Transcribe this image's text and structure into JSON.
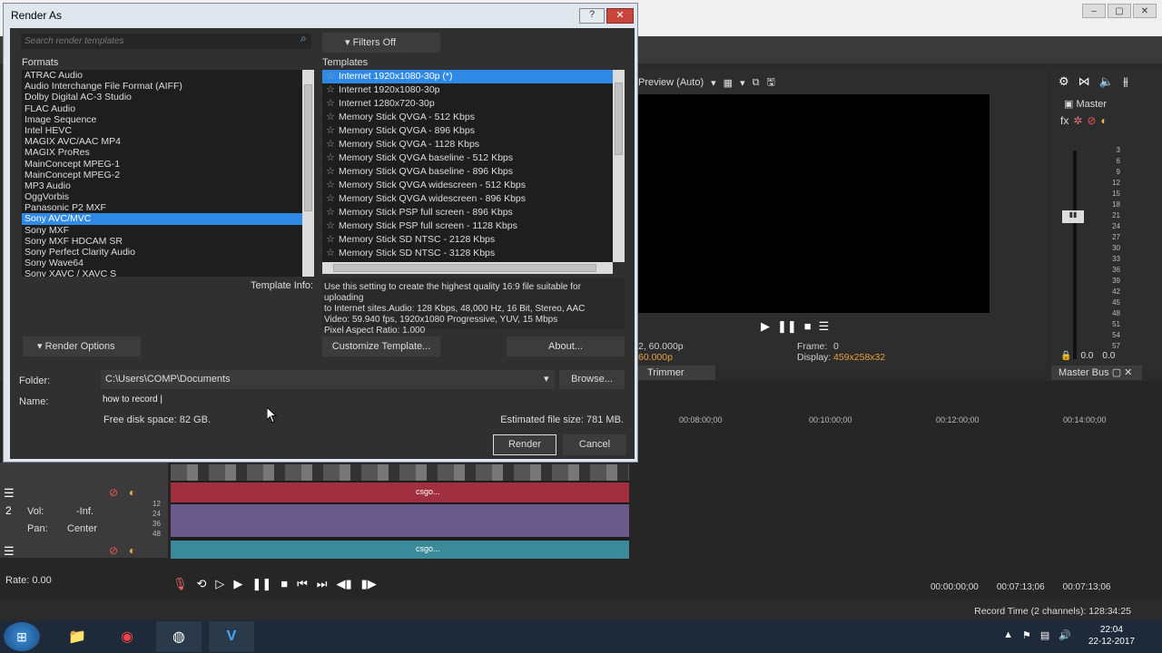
{
  "dialog": {
    "title": "Render As",
    "help_label": "?",
    "close_label": "✕",
    "search_placeholder": "Search render templates",
    "filters_label": "Filters Off",
    "formats_label": "Formats",
    "templates_label": "Templates",
    "formats": [
      {
        "label": "ATRAC Audio",
        "selected": false
      },
      {
        "label": "Audio Interchange File Format (AIFF)",
        "selected": false
      },
      {
        "label": "Dolby Digital AC-3 Studio",
        "selected": false
      },
      {
        "label": "FLAC Audio",
        "selected": false
      },
      {
        "label": "Image Sequence",
        "selected": false
      },
      {
        "label": "Intel HEVC",
        "selected": false
      },
      {
        "label": "MAGIX AVC/AAC MP4",
        "selected": false
      },
      {
        "label": "MAGIX ProRes",
        "selected": false
      },
      {
        "label": "MainConcept MPEG-1",
        "selected": false
      },
      {
        "label": "MainConcept MPEG-2",
        "selected": false
      },
      {
        "label": "MP3 Audio",
        "selected": false
      },
      {
        "label": "OggVorbis",
        "selected": false
      },
      {
        "label": "Panasonic P2 MXF",
        "selected": false
      },
      {
        "label": "Sony AVC/MVC",
        "selected": true
      },
      {
        "label": "Sony MXF",
        "selected": false
      },
      {
        "label": "Sony MXF HDCAM SR",
        "selected": false
      },
      {
        "label": "Sony Perfect Clarity Audio",
        "selected": false
      },
      {
        "label": "Sony Wave64",
        "selected": false
      },
      {
        "label": "Sony XAVC / XAVC S",
        "selected": false
      }
    ],
    "templates": [
      {
        "label": "Internet 1920x1080-30p (*)",
        "selected": true
      },
      {
        "label": "Internet 1920x1080-30p",
        "selected": false
      },
      {
        "label": "Internet 1280x720-30p",
        "selected": false
      },
      {
        "label": "Memory Stick QVGA - 512 Kbps",
        "selected": false
      },
      {
        "label": "Memory Stick QVGA - 896 Kbps",
        "selected": false
      },
      {
        "label": "Memory Stick QVGA - 1128 Kbps",
        "selected": false
      },
      {
        "label": "Memory Stick QVGA baseline - 512 Kbps",
        "selected": false
      },
      {
        "label": "Memory Stick QVGA baseline - 896 Kbps",
        "selected": false
      },
      {
        "label": "Memory Stick QVGA widescreen - 512 Kbps",
        "selected": false
      },
      {
        "label": "Memory Stick QVGA widescreen - 896 Kbps",
        "selected": false
      },
      {
        "label": "Memory Stick PSP full screen - 896 Kbps",
        "selected": false
      },
      {
        "label": "Memory Stick PSP full screen - 1128 Kbps",
        "selected": false
      },
      {
        "label": "Memory Stick SD NTSC - 2128 Kbps",
        "selected": false
      },
      {
        "label": "Memory Stick SD NTSC - 3128 Kbps",
        "selected": false
      }
    ],
    "template_info_label": "Template Info:",
    "template_info_lines": [
      "Use this setting to create the highest quality 16:9 file suitable for uploading",
      "to Internet sites.Audio: 128 Kbps, 48,000 Hz, 16 Bit, Stereo, AAC",
      "Video: 59.940 fps, 1920x1080 Progressive, YUV, 15 Mbps",
      "Pixel Aspect Ratio: 1.000"
    ],
    "render_options_label": "Render Options",
    "customize_label": "Customize Template...",
    "about_label": "About...",
    "folder_label": "Folder:",
    "folder_value": "C:\\Users\\COMP\\Documents",
    "browse_label": "Browse...",
    "name_label": "Name:",
    "name_value": "how to record |",
    "free_disk": "Free disk space: 82 GB.",
    "est_size": "Estimated file size: 781 MB.",
    "render_label": "Render",
    "cancel_label": "Cancel"
  },
  "preview": {
    "mode": "Preview (Auto)",
    "frame_label": "Frame:",
    "frame_value": "0",
    "display_label": "Display:",
    "display_value": "459x258x32",
    "project_info": "2, 60.000p",
    "preview_info": "60.000p",
    "trimmer_tab": "Trimmer"
  },
  "master": {
    "label": "Master",
    "scale": [
      "3",
      "6",
      "9",
      "12",
      "15",
      "18",
      "21",
      "24",
      "27",
      "30",
      "33",
      "36",
      "39",
      "42",
      "45",
      "48",
      "51",
      "54",
      "57"
    ],
    "left_value": "0.0",
    "right_value": "0.0",
    "bus_tab": "Master Bus"
  },
  "timeline": {
    "ruler_marks": [
      "00:08:00;00",
      "00:10:00;00",
      "00:12:00;00",
      "00:14:00;00"
    ],
    "track_number": "2",
    "vol_label": "Vol:",
    "vol_value": "-Inf.",
    "pan_label": "Pan:",
    "pan_value": "Center",
    "level_marks": [
      "12",
      "24",
      "36",
      "48"
    ],
    "event_label": "csgo...",
    "rate_label": "Rate: 0.00",
    "time_cursor": "00:00:00;00",
    "time_out": "00:07:13;06",
    "time_length": "00:07:13;06",
    "record_time": "Record Time (2 channels): 128:34:25"
  },
  "taskbar": {
    "time": "22:04",
    "date": "22-12-2017"
  },
  "colors": {
    "selection": "#2f8ae6",
    "dialog_bg": "#303030",
    "close_red": "#c9463d"
  }
}
